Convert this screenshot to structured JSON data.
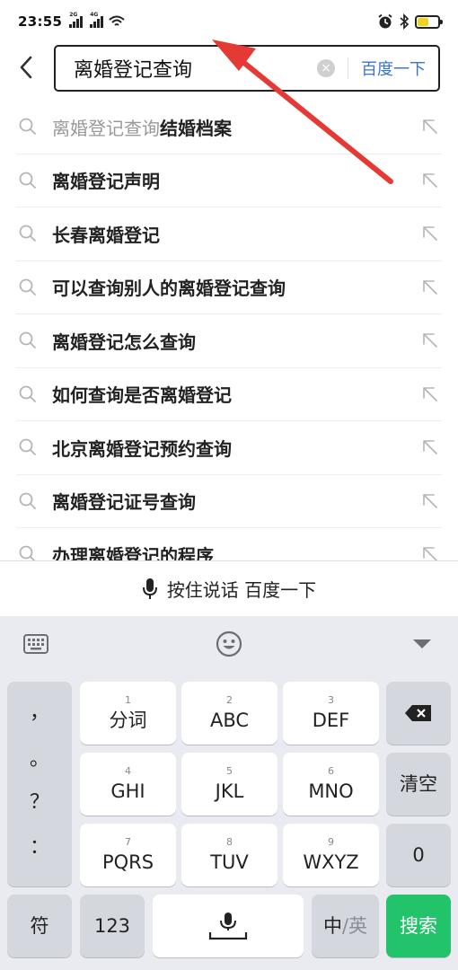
{
  "status_bar": {
    "time": "23:55",
    "signal_1_label": "2G",
    "signal_2_label": "4G",
    "icons": [
      "signal-icon",
      "wifi-icon",
      "alarm-icon",
      "bluetooth-icon",
      "battery-icon"
    ],
    "battery_level": 0.55
  },
  "search": {
    "value": "离婚登记查询",
    "button_label": "百度一下"
  },
  "suggestions": [
    {
      "prefix": "离婚登记查询",
      "text": "结婚档案"
    },
    {
      "prefix": "",
      "text": "离婚登记声明"
    },
    {
      "prefix": "",
      "text": "长春离婚登记"
    },
    {
      "prefix": "",
      "text": "可以查询别人的离婚登记查询"
    },
    {
      "prefix": "",
      "text": "离婚登记怎么查询"
    },
    {
      "prefix": "",
      "text": "如何查询是否离婚登记"
    },
    {
      "prefix": "",
      "text": "北京离婚登记预约查询"
    },
    {
      "prefix": "",
      "text": "离婚登记证号查询"
    },
    {
      "prefix": "",
      "text": "办理离婚登记的程序"
    }
  ],
  "voice_bar": {
    "label": "按住说话 百度一下"
  },
  "keyboard": {
    "punctuation": [
      "，",
      "。",
      "？",
      "："
    ],
    "keys": {
      "k1": {
        "num": "1",
        "label": "分词"
      },
      "k2": {
        "num": "2",
        "label": "ABC"
      },
      "k3": {
        "num": "3",
        "label": "DEF"
      },
      "k4": {
        "num": "4",
        "label": "GHI"
      },
      "k5": {
        "num": "5",
        "label": "JKL"
      },
      "k6": {
        "num": "6",
        "label": "MNO"
      },
      "k7": {
        "num": "7",
        "label": "PQRS"
      },
      "k8": {
        "num": "8",
        "label": "TUV"
      },
      "k9": {
        "num": "9",
        "label": "WXYZ"
      }
    },
    "clear_label": "清空",
    "zero_label": "0",
    "symbol_label": "符",
    "num_label": "123",
    "lang_zh": "中",
    "lang_sep": "/",
    "lang_en": "英",
    "search_label": "搜索"
  },
  "colors": {
    "accent_blue": "#3a72d8",
    "search_key_green": "#22c36b",
    "annotation_arrow_red": "#e53935"
  }
}
